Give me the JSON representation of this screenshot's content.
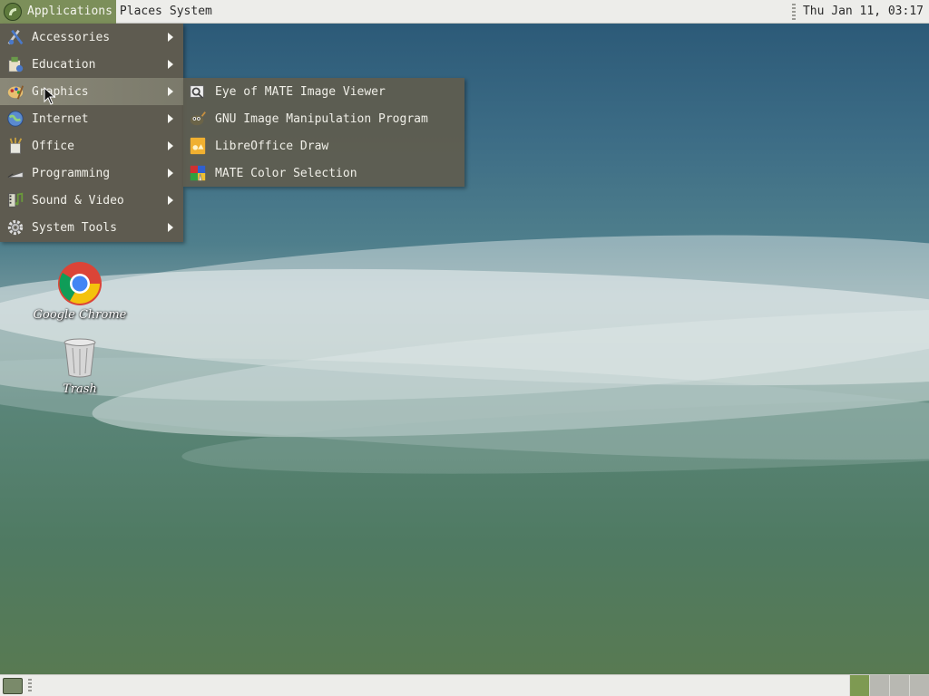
{
  "top_panel": {
    "menus": [
      "Applications",
      "Places",
      "System"
    ],
    "clock": "Thu Jan 11, 03:17"
  },
  "app_menu": {
    "items": [
      {
        "label": "Accessories",
        "icon": "accessories-icon"
      },
      {
        "label": "Education",
        "icon": "education-icon"
      },
      {
        "label": "Graphics",
        "icon": "graphics-icon"
      },
      {
        "label": "Internet",
        "icon": "internet-icon"
      },
      {
        "label": "Office",
        "icon": "office-icon"
      },
      {
        "label": "Programming",
        "icon": "programming-icon"
      },
      {
        "label": "Sound & Video",
        "icon": "sound-video-icon"
      },
      {
        "label": "System Tools",
        "icon": "system-tools-icon"
      }
    ],
    "highlighted": "Graphics"
  },
  "graphics_submenu": {
    "items": [
      {
        "label": "Eye of MATE Image Viewer",
        "icon": "image-viewer-icon"
      },
      {
        "label": "GNU Image Manipulation Program",
        "icon": "gimp-icon"
      },
      {
        "label": "LibreOffice Draw",
        "icon": "libreoffice-draw-icon"
      },
      {
        "label": "MATE Color Selection",
        "icon": "color-selection-icon"
      }
    ]
  },
  "desktop_icons": [
    {
      "label": "Google Chrome",
      "icon": "chrome-icon"
    },
    {
      "label": "Trash",
      "icon": "trash-icon"
    }
  ],
  "colors": {
    "menu_bg": "#5e5b50",
    "panel_bg": "#ededea",
    "active_menu": "#7c8f5a"
  }
}
